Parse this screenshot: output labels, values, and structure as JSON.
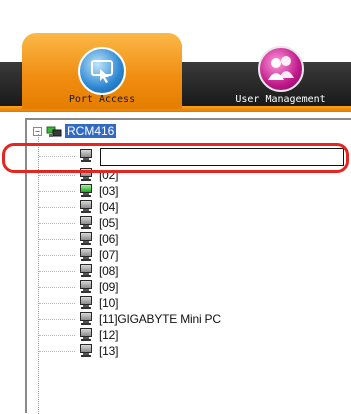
{
  "tabs": [
    {
      "label": "Port Access",
      "icon": "port-access-icon",
      "active": true
    },
    {
      "label": "User Management",
      "icon": "user-management-icon",
      "active": false
    }
  ],
  "tree": {
    "root": {
      "label": "RCM416",
      "expanded": true,
      "expander": "−"
    },
    "rename_input": {
      "value": "",
      "placeholder": ""
    },
    "ports": [
      {
        "label": "[02]",
        "online": false
      },
      {
        "label": "[03]",
        "online": true
      },
      {
        "label": "[04]",
        "online": false
      },
      {
        "label": "[05]",
        "online": false
      },
      {
        "label": "[06]",
        "online": false
      },
      {
        "label": "[07]",
        "online": false
      },
      {
        "label": "[08]",
        "online": false
      },
      {
        "label": "[09]",
        "online": false
      },
      {
        "label": "[10]",
        "online": false
      },
      {
        "label": "[11]GIGABYTE Mini PC",
        "online": false
      },
      {
        "label": "[12]",
        "online": false
      },
      {
        "label": "[13]",
        "online": false
      }
    ]
  },
  "colors": {
    "tab_active": "#f08c10",
    "header_bar": "#1e1e1e",
    "selection": "#316ac5",
    "highlight_ring": "#e52620",
    "pc_online": "#1ca81c"
  }
}
